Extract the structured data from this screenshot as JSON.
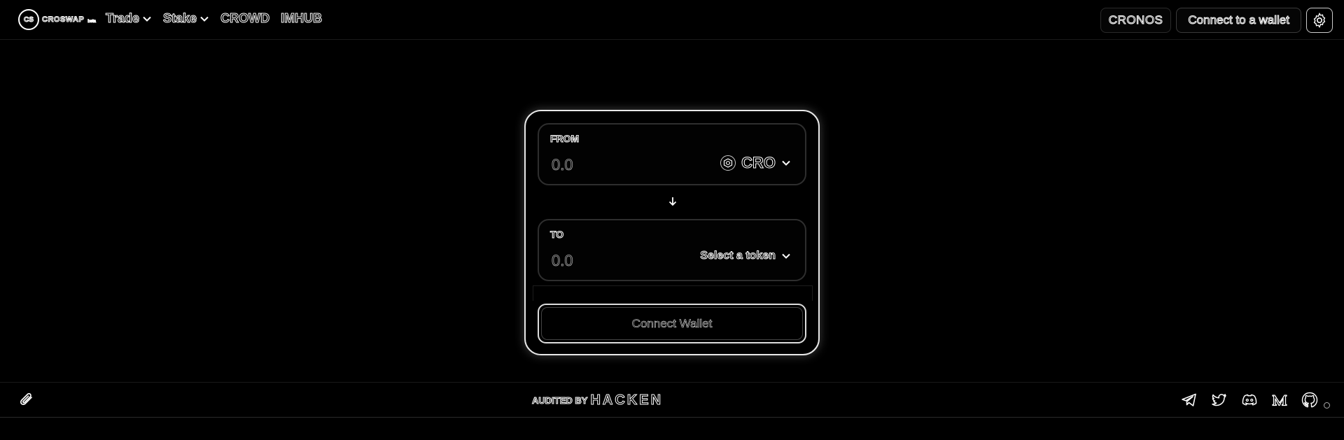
{
  "header": {
    "logo_text": "CROSWAP",
    "logo_mark": "CS",
    "logo_sub": "beta",
    "nav": [
      {
        "label": "Trade",
        "has_dropdown": true
      },
      {
        "label": "Stake",
        "has_dropdown": true
      },
      {
        "label": "CROWD",
        "has_dropdown": false
      },
      {
        "label": "IMHUB",
        "has_dropdown": false
      }
    ],
    "network_label": "CRONOS",
    "connect_wallet_label": "Connect to a wallet",
    "settings_icon": "gear-icon"
  },
  "swap": {
    "from": {
      "label": "FROM",
      "placeholder": "0.0",
      "token": "CRO",
      "token_icon": "cro-token-icon"
    },
    "to": {
      "label": "TO",
      "placeholder": "0.0",
      "token_prompt": "Select a token"
    },
    "swap_direction_icon": "arrow-down-icon",
    "connect_button_label": "Connect Wallet"
  },
  "footer": {
    "link_icon": "paperclip-icon",
    "audited_label": "AUDITED BY",
    "auditor": "HACKEN",
    "socials": [
      "telegram-icon",
      "twitter-icon",
      "discord-icon",
      "medium-icon",
      "github-icon"
    ]
  },
  "colors": {
    "background": "#000000",
    "outline": "#ffffff"
  }
}
